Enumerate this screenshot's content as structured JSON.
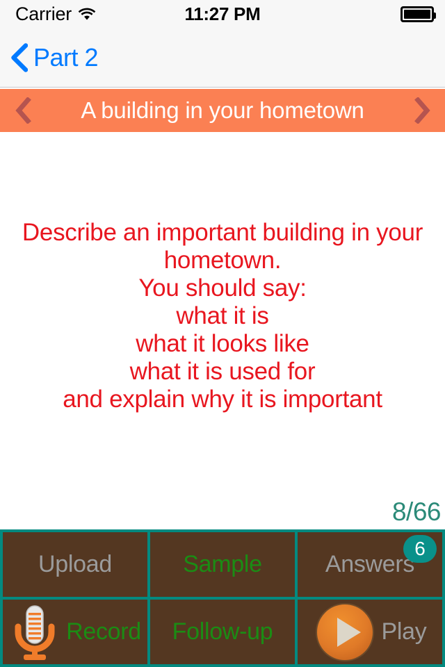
{
  "status_bar": {
    "carrier": "Carrier",
    "wifi_icon": "wifi-icon",
    "time": "11:27 PM",
    "battery_icon": "battery-full-icon"
  },
  "nav_bar": {
    "back_icon": "chevron-left-icon",
    "back_label": "Part 2",
    "accent_color": "#007aff"
  },
  "topic_bar": {
    "prev_icon": "chevron-left-icon",
    "title": "A building in your hometown",
    "next_icon": "chevron-right-icon",
    "background_color": "#fb8053",
    "arrow_color": "#b5544f",
    "title_color": "#ffffff"
  },
  "question": {
    "text": "Describe an important building in your hometown.\nYou should say:\nwhat it is\nwhat it looks like\nwhat it is used for\nand explain why it is important",
    "color": "#e8161f"
  },
  "counter": {
    "value": "8/66",
    "color": "#2b8a78"
  },
  "buttons": {
    "grid_background": "#038a80",
    "cell_background": "#543721",
    "row1": [
      {
        "label": "Upload",
        "label_color": "#9b9b9b",
        "icon": null,
        "badge": null
      },
      {
        "label": "Sample",
        "label_color": "#1b8c14",
        "icon": null,
        "badge": null
      },
      {
        "label": "Answers",
        "label_color": "#9b9b9b",
        "icon": null,
        "badge": "6"
      }
    ],
    "row2": [
      {
        "label": "Record",
        "label_color": "#1b8c14",
        "icon": "microphone-icon",
        "badge": null
      },
      {
        "label": "Follow-up",
        "label_color": "#1b8c14",
        "icon": null,
        "badge": null
      },
      {
        "label": "Play",
        "label_color": "#9b9b9b",
        "icon": "play-icon",
        "badge": null
      }
    ]
  }
}
